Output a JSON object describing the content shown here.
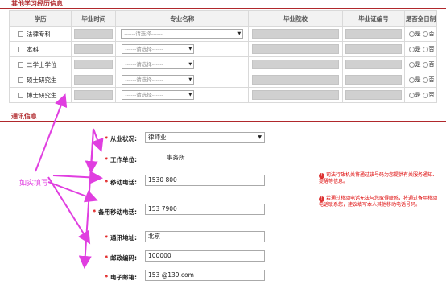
{
  "education_section": {
    "title": "其他学习经历信息"
  },
  "table": {
    "headers": [
      "学历",
      "毕业时间",
      "专业名称",
      "毕业院校",
      "毕业证编号",
      "是否全日制"
    ],
    "rows": [
      {
        "degree": "法律专科",
        "major_placeholder": "------请选择------"
      },
      {
        "degree": "本科",
        "major_placeholder": "------请选择------"
      },
      {
        "degree": "二学士学位",
        "major_placeholder": "------请选择------"
      },
      {
        "degree": "硕士研究生",
        "major_placeholder": "------请选择------"
      },
      {
        "degree": "博士研究生",
        "major_placeholder": "------请选择------"
      }
    ],
    "yes_label": "是",
    "no_label": "否"
  },
  "contact_section": {
    "title": "通讯信息"
  },
  "form": {
    "star": "*",
    "occupation": {
      "label": "从业状况:",
      "value": "律师业"
    },
    "employer": {
      "label": "工作单位:",
      "value": "事务所"
    },
    "mobile": {
      "label": "移动电话:",
      "value": "1530 800"
    },
    "backup_mobile": {
      "label": "备用移动电话:",
      "value": "153 7900"
    },
    "address": {
      "label": "通讯地址:",
      "value": "北京"
    },
    "postcode": {
      "label": "邮政编码:",
      "value": "100000"
    },
    "email": {
      "label": "电子邮箱:",
      "value": "153 @139.com"
    }
  },
  "notes": {
    "mobile_note": "司法行政机关将通过该号码为您提供有关服务通知、提醒等信息。",
    "backup_note": "若通过移动电话无法与您取得联系，将通过备用移动电话联系您，建议填写本人其他移动电话号码。"
  },
  "annotation": {
    "hint": "如实填写",
    "color": "#e03ee0"
  }
}
